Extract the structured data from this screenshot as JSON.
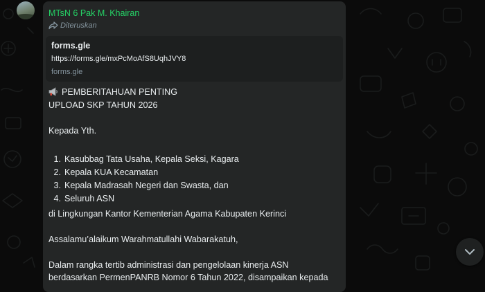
{
  "message": {
    "sender": "MTsN 6 Pak M. Khairan",
    "forwarded_label": "Diteruskan",
    "link_preview": {
      "title": "forms.gle",
      "url": "https://forms.gle/mxPcMoAfS8UqhJVY8",
      "domain": "forms.gle"
    },
    "heading_line1": "PEMBERITAHUAN PENTING",
    "heading_line2": "UPLOAD SKP TAHUN 2026",
    "greeting_to": "Kepada Yth.",
    "recipients": [
      {
        "num": "1.",
        "text": "Kasubbag Tata Usaha, Kepala Seksi, Kagara"
      },
      {
        "num": "2.",
        "text": "Kepala KUA Kecamatan"
      },
      {
        "num": "3.",
        "text": "Kepala Madrasah Negeri dan Swasta, dan"
      },
      {
        "num": "4.",
        "text": "Seluruh ASN"
      }
    ],
    "location": "di Lingkungan Kantor Kementerian Agama Kabupaten Kerinci",
    "salam": "Assalamu’alaikum Warahmatullahi Wabarakatuh,",
    "body_line1": "Dalam rangka tertib administrasi dan pengelolaan kinerja ASN",
    "body_line2": "berdasarkan PermenPANRB Nomor 6 Tahun 2022, disampaikan kepada"
  },
  "icons": {
    "forward": "forward-arrow-icon",
    "megaphone": "megaphone-icon",
    "scroll_down": "chevron-down-icon"
  },
  "colors": {
    "background": "#0b0b0b",
    "bubble": "#242626",
    "link_card": "#1d1f1f",
    "sender_name": "#25d366",
    "text": "#e9edef",
    "muted": "#8696a0"
  }
}
